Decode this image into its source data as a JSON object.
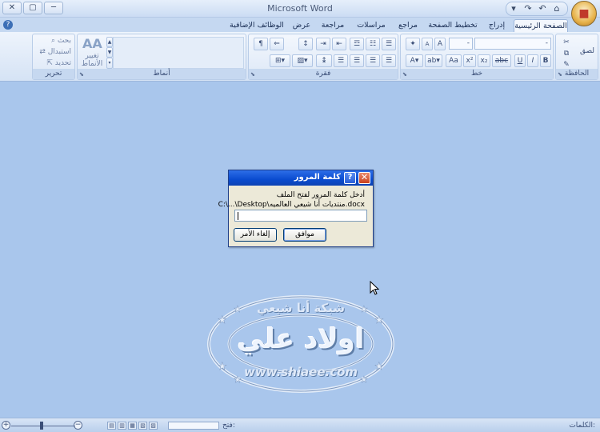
{
  "window": {
    "title": "Microsoft Word",
    "minimize": "─",
    "maximize": "▢",
    "close": "✕",
    "qat": [
      "⌂",
      "↶",
      "↷",
      "▾"
    ],
    "office_button_icon": "office-logo-icon"
  },
  "tabs": [
    {
      "label": "الصفحة الرئيسية",
      "active": true
    },
    {
      "label": "إدراج",
      "active": false
    },
    {
      "label": "تخطيط الصفحة",
      "active": false
    },
    {
      "label": "مراجع",
      "active": false
    },
    {
      "label": "مراسلات",
      "active": false
    },
    {
      "label": "مراجعة",
      "active": false
    },
    {
      "label": "عرض",
      "active": false
    },
    {
      "label": "الوظائف الإضافية",
      "active": false
    }
  ],
  "help": "?",
  "ribbon": {
    "groups": {
      "clipboard": {
        "label": "الحافظة",
        "paste": "لصق"
      },
      "font": {
        "label": "خط",
        "bold": "B",
        "italic": "I",
        "underline": "U",
        "strike": "abc",
        "grow": "A",
        "shrink": "A",
        "case": "Aa"
      },
      "paragraph": {
        "label": "فقرة",
        "pilcrow": "¶"
      },
      "styles": {
        "label": "أنماط",
        "change_styles": "تغيير الأنماط",
        "sample": "AA"
      },
      "editing": {
        "label": "تحرير",
        "find": "بحث",
        "replace": "استبدال",
        "select": "تحديد"
      }
    }
  },
  "dialog": {
    "title": "كلمة المرور",
    "help": "?",
    "close": "✕",
    "prompt": "أدخل كلمة المرور لفتح الملف",
    "file_path": "C:\\...\\Desktop\\منتديات أنا شيعي العالميه.docx",
    "password_value": "",
    "ok": "موافق",
    "cancel": "إلغاء الأمر"
  },
  "watermark": {
    "top": "شبكة أنا شيعي",
    "center": "اولاد علي",
    "bottom": "www.shiaee.com"
  },
  "statusbar": {
    "page": "الكلمات: ",
    "open_label": "فتح:",
    "zoom_minus": "−",
    "zoom_plus": "+"
  }
}
